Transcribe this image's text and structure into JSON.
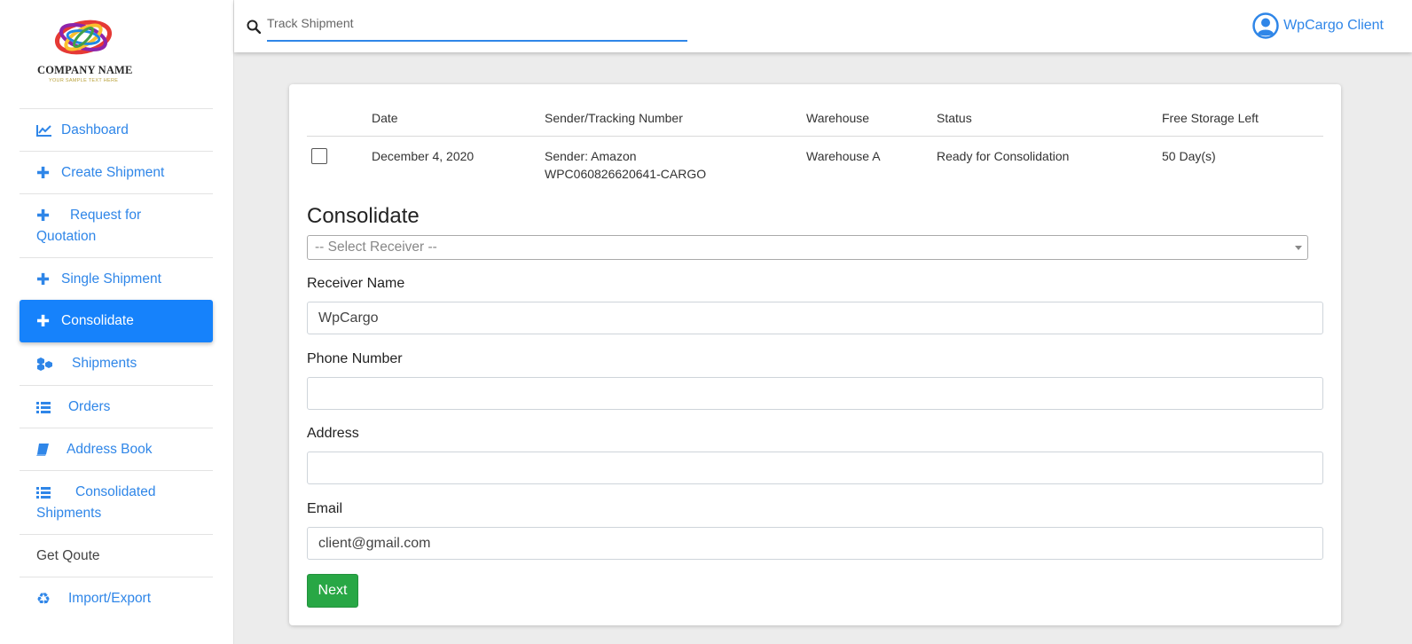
{
  "brand": {
    "name": "COMPANY NAME",
    "tagline": "YOUR SAMPLE TEXT HERE"
  },
  "sidebar": {
    "items": [
      {
        "label": "Dashboard",
        "icon": "chart-line-icon"
      },
      {
        "label": "Create Shipment",
        "icon": "plus-icon"
      },
      {
        "label": "Request for Quotation",
        "icon": "plus-icon"
      },
      {
        "label": "Single Shipment",
        "icon": "plus-icon"
      },
      {
        "label": "Consolidate",
        "icon": "plus-icon",
        "active": true
      },
      {
        "label": "Shipments",
        "icon": "cubes-icon"
      },
      {
        "label": "Orders",
        "icon": "list-icon"
      },
      {
        "label": "Address Book",
        "icon": "book-icon"
      },
      {
        "label": "Consolidated Shipments",
        "icon": "list-icon"
      },
      {
        "label": "Get Qoute"
      },
      {
        "label": "Import/Export",
        "icon": "recycle-icon"
      }
    ]
  },
  "topbar": {
    "search_placeholder": "Track Shipment",
    "user_name": "WpCargo Client"
  },
  "table": {
    "headers": [
      "Date",
      "Sender/Tracking Number",
      "Warehouse",
      "Status",
      "Free Storage Left"
    ],
    "rows": [
      {
        "date": "December 4, 2020",
        "sender": "Sender: Amazon",
        "tracking": "WPC060826620641-CARGO",
        "warehouse": "Warehouse A",
        "status": "Ready for Consolidation",
        "storage": "50 Day(s)"
      }
    ]
  },
  "form": {
    "title": "Consolidate",
    "receiver_select": "-- Select Receiver --",
    "receiver_name_label": "Receiver Name",
    "receiver_name_value": "WpCargo",
    "phone_label": "Phone Number",
    "phone_value": "",
    "address_label": "Address",
    "address_value": "",
    "email_label": "Email",
    "email_value": "client@gmail.com",
    "next_label": "Next"
  },
  "colors": {
    "accent": "#1682fb",
    "link": "#2f86e8",
    "success": "#28a745",
    "background": "#ececec"
  }
}
